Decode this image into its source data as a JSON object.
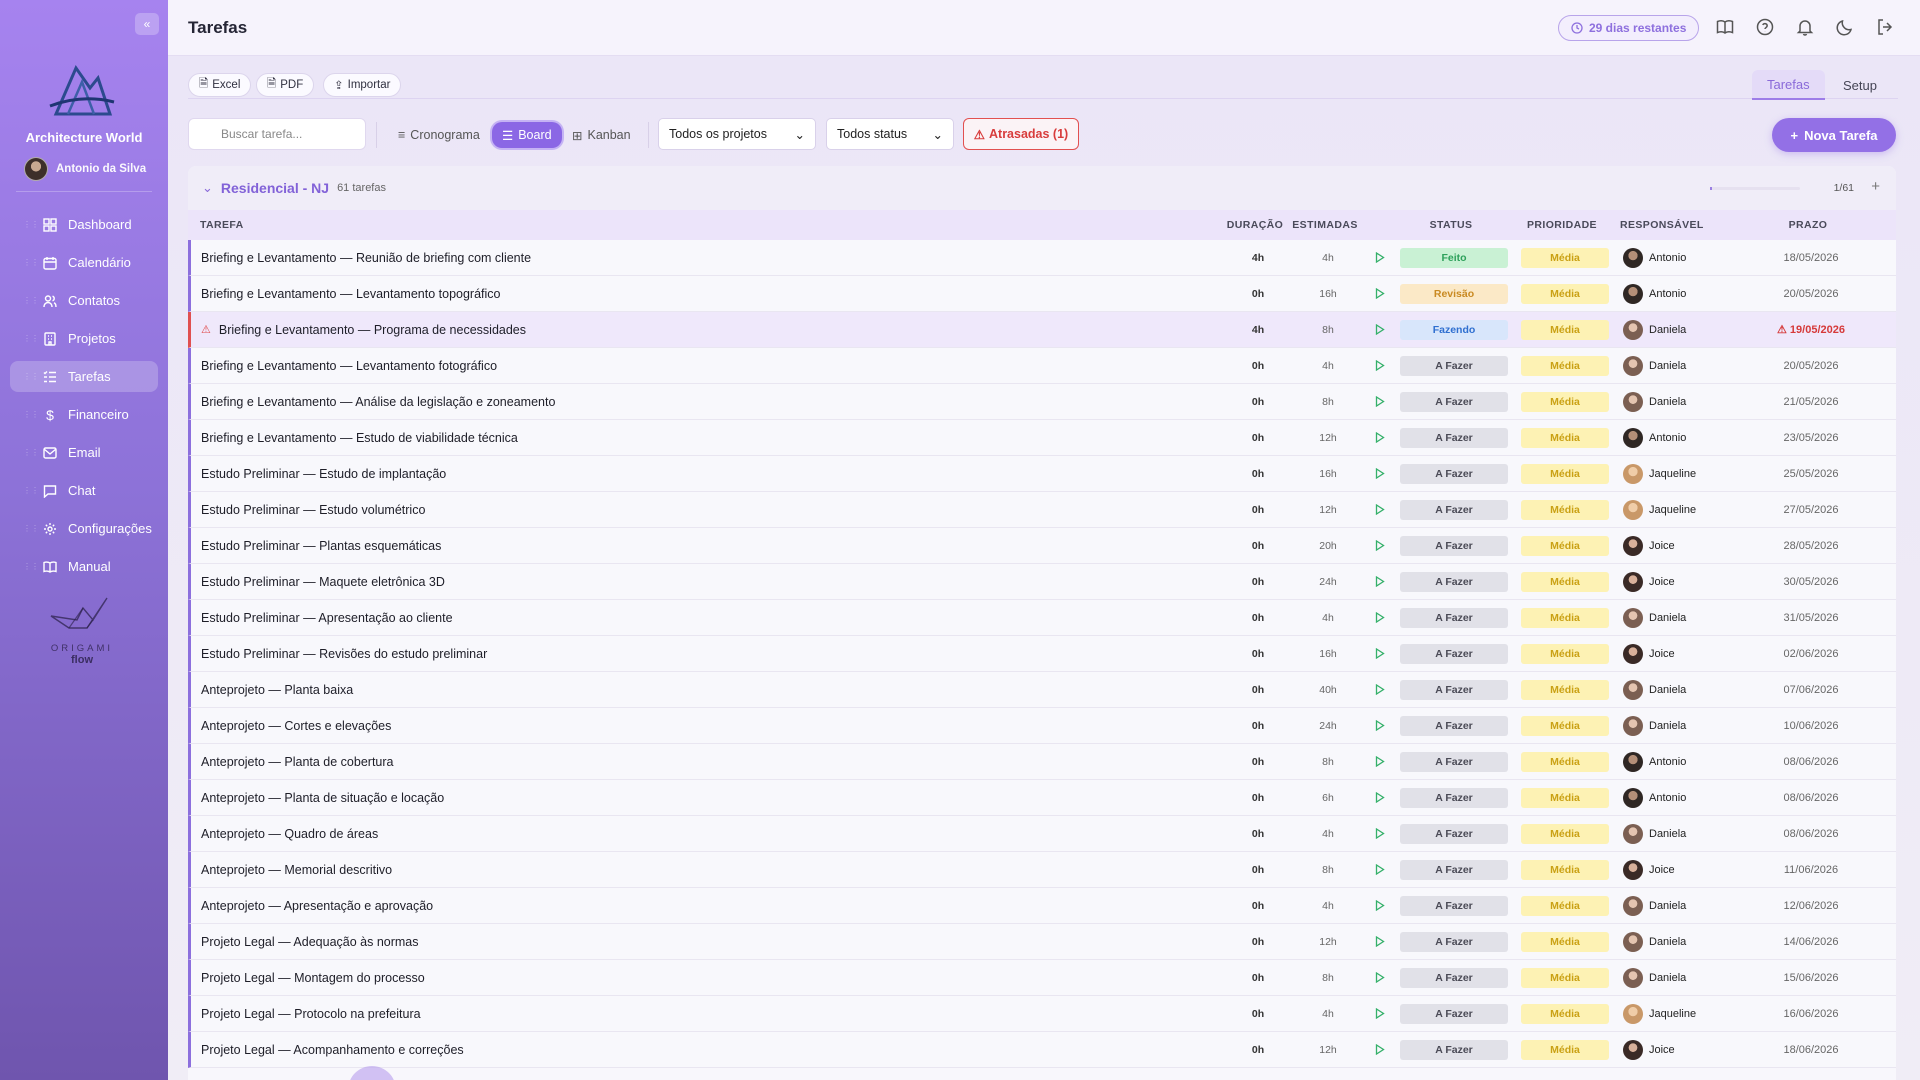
{
  "sidebar": {
    "brand": "Architecture World",
    "user": "Antonio da Silva",
    "items": [
      {
        "label": "Dashboard",
        "icon": "grid-icon",
        "active": false
      },
      {
        "label": "Calendário",
        "icon": "calendar-icon",
        "active": false
      },
      {
        "label": "Contatos",
        "icon": "users-icon",
        "active": false
      },
      {
        "label": "Projetos",
        "icon": "building-icon",
        "active": false
      },
      {
        "label": "Tarefas",
        "icon": "list-icon",
        "active": true
      },
      {
        "label": "Financeiro",
        "icon": "dollar-icon",
        "active": false
      },
      {
        "label": "Email",
        "icon": "mail-icon",
        "active": false
      },
      {
        "label": "Chat",
        "icon": "chat-icon",
        "active": false
      },
      {
        "label": "Configurações",
        "icon": "gear-icon",
        "active": false
      },
      {
        "label": "Manual",
        "icon": "book-icon",
        "active": false
      }
    ],
    "footer_logo_1": "ORIGAMI",
    "footer_logo_2": "flow"
  },
  "header": {
    "title": "Tarefas",
    "trial": "29 dias restantes"
  },
  "toolbar": {
    "excel": "Excel",
    "pdf": "PDF",
    "import": "Importar",
    "tab_tasks": "Tarefas",
    "tab_setup": "Setup",
    "search_placeholder": "Buscar tarefa...",
    "view_schedule": "Cronograma",
    "view_board": "Board",
    "view_kanban": "Kanban",
    "filter_projects": "Todos os projetos",
    "filter_status": "Todos status",
    "overdue": "Atrasadas (1)",
    "new_task": "Nova Tarefa"
  },
  "group": {
    "title": "Residencial - NJ",
    "count": "61 tarefas",
    "pages": "1/61"
  },
  "columns": {
    "task": "TAREFA",
    "duration": "DURAÇÃO",
    "estimated": "ESTIMADAS",
    "status": "STATUS",
    "priority": "PRIORIDADE",
    "owner": "RESPONSÁVEL",
    "due": "PRAZO"
  },
  "rows": [
    {
      "task": "Briefing e Levantamento — Reunião de briefing com cliente",
      "dur": "4h",
      "est": "4h",
      "status": "Feito",
      "status_kind": "done",
      "prio": "Média",
      "owner": "Antonio",
      "due": "18/05/2026",
      "late": false
    },
    {
      "task": "Briefing e Levantamento — Levantamento topográfico",
      "dur": "0h",
      "est": "16h",
      "status": "Revisão",
      "status_kind": "review",
      "prio": "Média",
      "owner": "Antonio",
      "due": "20/05/2026",
      "late": false
    },
    {
      "task": "Briefing e Levantamento — Programa de necessidades",
      "dur": "4h",
      "est": "8h",
      "status": "Fazendo",
      "status_kind": "doing",
      "prio": "Média",
      "owner": "Daniela",
      "due": "19/05/2026",
      "late": true
    },
    {
      "task": "Briefing e Levantamento — Levantamento fotográfico",
      "dur": "0h",
      "est": "4h",
      "status": "A Fazer",
      "status_kind": "todo",
      "prio": "Média",
      "owner": "Daniela",
      "due": "20/05/2026",
      "late": false
    },
    {
      "task": "Briefing e Levantamento — Análise da legislação e zoneamento",
      "dur": "0h",
      "est": "8h",
      "status": "A Fazer",
      "status_kind": "todo",
      "prio": "Média",
      "owner": "Daniela",
      "due": "21/05/2026",
      "late": false
    },
    {
      "task": "Briefing e Levantamento — Estudo de viabilidade técnica",
      "dur": "0h",
      "est": "12h",
      "status": "A Fazer",
      "status_kind": "todo",
      "prio": "Média",
      "owner": "Antonio",
      "due": "23/05/2026",
      "late": false
    },
    {
      "task": "Estudo Preliminar — Estudo de implantação",
      "dur": "0h",
      "est": "16h",
      "status": "A Fazer",
      "status_kind": "todo",
      "prio": "Média",
      "owner": "Jaqueline",
      "due": "25/05/2026",
      "late": false
    },
    {
      "task": "Estudo Preliminar — Estudo volumétrico",
      "dur": "0h",
      "est": "12h",
      "status": "A Fazer",
      "status_kind": "todo",
      "prio": "Média",
      "owner": "Jaqueline",
      "due": "27/05/2026",
      "late": false
    },
    {
      "task": "Estudo Preliminar — Plantas esquemáticas",
      "dur": "0h",
      "est": "20h",
      "status": "A Fazer",
      "status_kind": "todo",
      "prio": "Média",
      "owner": "Joice",
      "due": "28/05/2026",
      "late": false
    },
    {
      "task": "Estudo Preliminar — Maquete eletrônica 3D",
      "dur": "0h",
      "est": "24h",
      "status": "A Fazer",
      "status_kind": "todo",
      "prio": "Média",
      "owner": "Joice",
      "due": "30/05/2026",
      "late": false
    },
    {
      "task": "Estudo Preliminar — Apresentação ao cliente",
      "dur": "0h",
      "est": "4h",
      "status": "A Fazer",
      "status_kind": "todo",
      "prio": "Média",
      "owner": "Daniela",
      "due": "31/05/2026",
      "late": false
    },
    {
      "task": "Estudo Preliminar — Revisões do estudo preliminar",
      "dur": "0h",
      "est": "16h",
      "status": "A Fazer",
      "status_kind": "todo",
      "prio": "Média",
      "owner": "Joice",
      "due": "02/06/2026",
      "late": false
    },
    {
      "task": "Anteprojeto — Planta baixa",
      "dur": "0h",
      "est": "40h",
      "status": "A Fazer",
      "status_kind": "todo",
      "prio": "Média",
      "owner": "Daniela",
      "due": "07/06/2026",
      "late": false
    },
    {
      "task": "Anteprojeto — Cortes e elevações",
      "dur": "0h",
      "est": "24h",
      "status": "A Fazer",
      "status_kind": "todo",
      "prio": "Média",
      "owner": "Daniela",
      "due": "10/06/2026",
      "late": false
    },
    {
      "task": "Anteprojeto — Planta de cobertura",
      "dur": "0h",
      "est": "8h",
      "status": "A Fazer",
      "status_kind": "todo",
      "prio": "Média",
      "owner": "Antonio",
      "due": "08/06/2026",
      "late": false
    },
    {
      "task": "Anteprojeto — Planta de situação e locação",
      "dur": "0h",
      "est": "6h",
      "status": "A Fazer",
      "status_kind": "todo",
      "prio": "Média",
      "owner": "Antonio",
      "due": "08/06/2026",
      "late": false
    },
    {
      "task": "Anteprojeto — Quadro de áreas",
      "dur": "0h",
      "est": "4h",
      "status": "A Fazer",
      "status_kind": "todo",
      "prio": "Média",
      "owner": "Daniela",
      "due": "08/06/2026",
      "late": false
    },
    {
      "task": "Anteprojeto — Memorial descritivo",
      "dur": "0h",
      "est": "8h",
      "status": "A Fazer",
      "status_kind": "todo",
      "prio": "Média",
      "owner": "Joice",
      "due": "11/06/2026",
      "late": false
    },
    {
      "task": "Anteprojeto — Apresentação e aprovação",
      "dur": "0h",
      "est": "4h",
      "status": "A Fazer",
      "status_kind": "todo",
      "prio": "Média",
      "owner": "Daniela",
      "due": "12/06/2026",
      "late": false
    },
    {
      "task": "Projeto Legal — Adequação às normas",
      "dur": "0h",
      "est": "12h",
      "status": "A Fazer",
      "status_kind": "todo",
      "prio": "Média",
      "owner": "Daniela",
      "due": "14/06/2026",
      "late": false
    },
    {
      "task": "Projeto Legal — Montagem do processo",
      "dur": "0h",
      "est": "8h",
      "status": "A Fazer",
      "status_kind": "todo",
      "prio": "Média",
      "owner": "Daniela",
      "due": "15/06/2026",
      "late": false
    },
    {
      "task": "Projeto Legal — Protocolo na prefeitura",
      "dur": "0h",
      "est": "4h",
      "status": "A Fazer",
      "status_kind": "todo",
      "prio": "Média",
      "owner": "Jaqueline",
      "due": "16/06/2026",
      "late": false
    },
    {
      "task": "Projeto Legal — Acompanhamento e correções",
      "dur": "0h",
      "est": "12h",
      "status": "A Fazer",
      "status_kind": "todo",
      "prio": "Média",
      "owner": "Joice",
      "due": "18/06/2026",
      "late": false
    }
  ],
  "colors": {
    "accent": "#9370e6",
    "done": "#2ea15b",
    "review": "#c98a22",
    "doing": "#2f6fd0",
    "overdue": "#d83c3c",
    "priority": "#caa114"
  }
}
